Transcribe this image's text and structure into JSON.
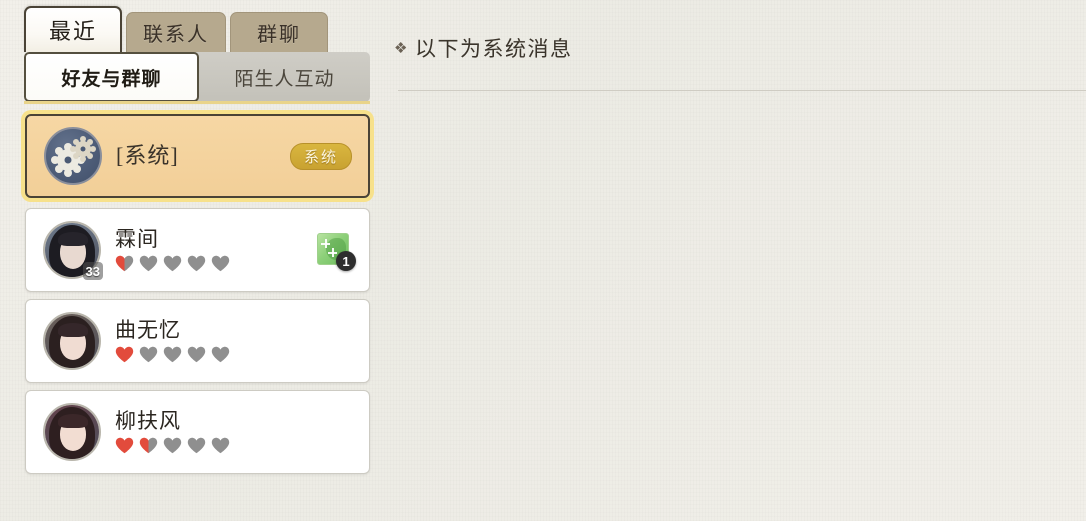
{
  "window": {
    "accent_gold": "#d9b63f",
    "selected_bg": "#f4d29c",
    "tab_inactive_bg": "#b6a98e",
    "paper_bg": "#f0eee8",
    "heart_full_color": "#e24b3c",
    "heart_empty_color": "#8f8f8f"
  },
  "tabs": [
    {
      "label": "最近",
      "active": true,
      "name": "tab-recent"
    },
    {
      "label": "联系人",
      "active": false,
      "name": "tab-contacts"
    },
    {
      "label": "群聊",
      "active": false,
      "name": "tab-group-chat"
    }
  ],
  "subtabs": [
    {
      "label": "好友与群聊",
      "active": true,
      "name": "subtab-friends-and-groups"
    },
    {
      "label": "陌生人互动",
      "active": false,
      "name": "subtab-stranger-interaction"
    }
  ],
  "conversations": [
    {
      "name": "[系统]",
      "type": "system",
      "selected": true,
      "badge": "系统",
      "avatar_icon": "gears-icon",
      "level": null,
      "hearts_total": 0,
      "hearts_filled": 0,
      "gift_count": null
    },
    {
      "name": "霖间",
      "type": "friend",
      "selected": false,
      "badge": null,
      "avatar_icon": "portrait-avatar",
      "level": "33",
      "hearts_total": 5,
      "hearts_filled": 0.5,
      "gift_count": "1"
    },
    {
      "name": "曲无忆",
      "type": "friend",
      "selected": false,
      "badge": null,
      "avatar_icon": "portrait-avatar",
      "level": null,
      "hearts_total": 5,
      "hearts_filled": 1,
      "gift_count": null
    },
    {
      "name": "柳扶风",
      "type": "friend",
      "selected": false,
      "badge": null,
      "avatar_icon": "portrait-avatar",
      "level": null,
      "hearts_total": 5,
      "hearts_filled": 1.5,
      "gift_count": null
    }
  ],
  "message_panel": {
    "ornament": "❖",
    "notice": "以下为系统消息",
    "messages": []
  }
}
